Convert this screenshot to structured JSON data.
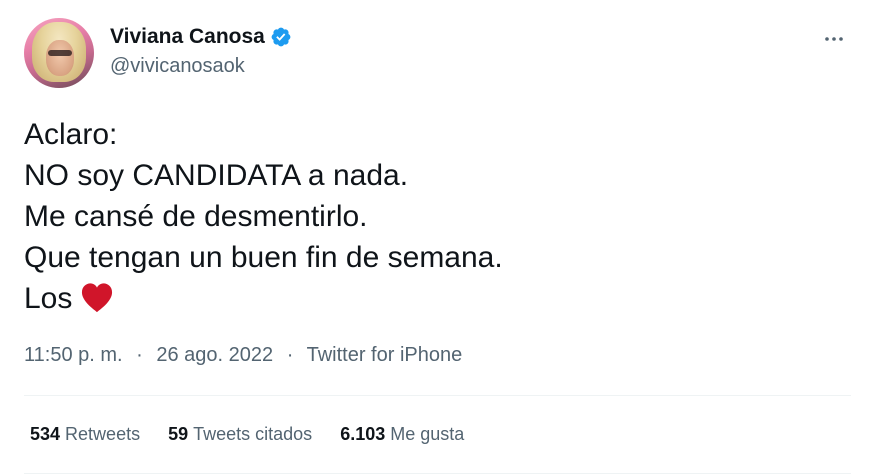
{
  "author": {
    "display_name": "Viviana Canosa",
    "handle": "@vivicanosaok",
    "verified": true
  },
  "menu_icon": "more-dots-icon",
  "tweet": {
    "lines": [
      "Aclaro:",
      "NO soy CANDIDATA a nada.",
      "Me cansé de desmentirlo.",
      "Que tengan un buen fin de semana.",
      "Los"
    ],
    "emoji": "red-heart-icon"
  },
  "meta": {
    "time": "11:50 p. m.",
    "separator": "·",
    "date": "26 ago. 2022",
    "source": "Twitter for iPhone"
  },
  "stats": {
    "retweets_count": "534",
    "retweets_label": "Retweets",
    "quotes_count": "59",
    "quotes_label": "Tweets citados",
    "likes_count": "6.103",
    "likes_label": "Me gusta"
  },
  "colors": {
    "text_primary": "#0f1419",
    "text_secondary": "#536471",
    "verified_blue": "#1d9bf0",
    "heart_red": "#d0152a",
    "divider": "#eff3f4"
  }
}
